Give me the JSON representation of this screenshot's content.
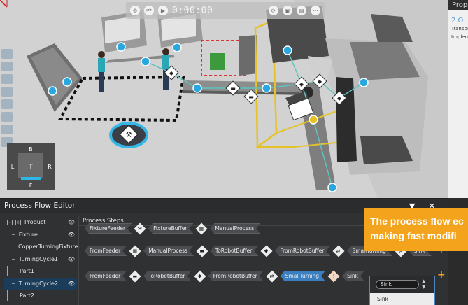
{
  "playbar": {
    "time": "0:00:00"
  },
  "viewcube": {
    "top": "B",
    "left": "L",
    "center": "T",
    "right": "R",
    "bottom": "F"
  },
  "properties": {
    "header": "Prope",
    "title": "2 O",
    "line1": "Transpo",
    "line2": "Implem"
  },
  "editor": {
    "title": "Process Flow Editor",
    "pin_glyph": "▼",
    "close_glyph": "✕"
  },
  "products": {
    "header": "Product",
    "expand_glyph": "−",
    "collapse_glyph": "+",
    "items": [
      {
        "label": "Fixture",
        "kind": "group"
      },
      {
        "label": "CopperTurningFixture",
        "kind": "part"
      },
      {
        "label": "TurningCycle1",
        "kind": "group"
      },
      {
        "label": "Part1",
        "kind": "part"
      },
      {
        "label": "TurningCycle2",
        "kind": "group",
        "selected": true
      },
      {
        "label": "Part2",
        "kind": "part"
      }
    ]
  },
  "process_steps": {
    "header": "Process Steps",
    "flows": [
      {
        "steps": [
          "FixtureFeeder",
          "FixtureBuffer",
          "ManualProcess"
        ]
      },
      {
        "steps": [
          "FromFeeder",
          "ManualProcess",
          "ToRobotBuffer",
          "FromRobotBuffer",
          "SmallTurning",
          "Sink"
        ]
      },
      {
        "steps": [
          "FromFeeder",
          "ToRobotBuffer",
          "FromRobotBuffer",
          "SmallTurning",
          "Sink"
        ],
        "active_step": "SmallTurning"
      }
    ]
  },
  "sink_dropdown": {
    "value": "Sink",
    "option": "Sink"
  },
  "callout": {
    "line1": "The process flow ec",
    "line2": "making fast modifi"
  },
  "colors": {
    "accent_blue": "#3a7fc0",
    "callout_orange": "#f4a41c",
    "plus_green": "#6bc24a",
    "node_cyan": "#29a8e0"
  }
}
